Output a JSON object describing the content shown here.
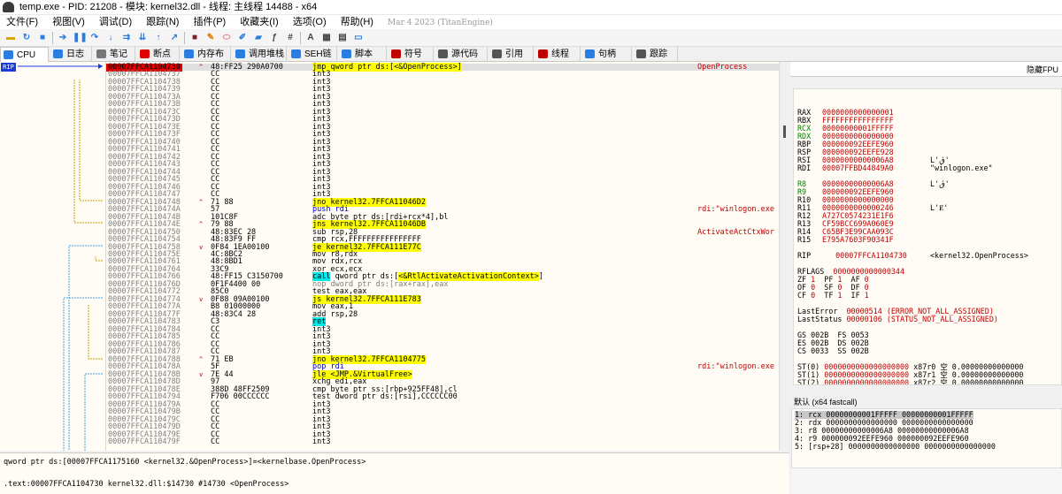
{
  "window": {
    "title": "temp.exe - PID: 21208 - 模块: kernel32.dll - 线程: 主线程 14488 - x64"
  },
  "menu": {
    "items": [
      "文件(F)",
      "视图(V)",
      "调试(D)",
      "跟踪(N)",
      "插件(P)",
      "收藏夹(I)",
      "选项(O)",
      "帮助(H)"
    ],
    "build": "Mar 4 2023 (TitanEngine)"
  },
  "toolbar": {
    "icons": [
      "open-icon",
      "restart-icon",
      "close-icon",
      "run-icon",
      "pause-icon",
      "step-into-icon",
      "step-over-icon",
      "trace-into-icon",
      "trace-over-icon",
      "execute-till-return-icon",
      "run-to-user-code-icon",
      "scylla-icon",
      "patch-icon",
      "comment-icon",
      "label-icon",
      "bookmark-icon",
      "function-icon",
      "hash-icon",
      "font-icon",
      "calc-icon",
      "log-icon",
      "screen-icon"
    ]
  },
  "tabs": [
    {
      "label": "CPU",
      "icon": "cpu-icon",
      "active": true
    },
    {
      "label": "日志",
      "icon": "log-icon"
    },
    {
      "label": "笔记",
      "icon": "notes-icon"
    },
    {
      "label": "断点",
      "icon": "breakpoint-icon"
    },
    {
      "label": "内存布局",
      "icon": "memory-icon"
    },
    {
      "label": "调用堆栈",
      "icon": "callstack-icon"
    },
    {
      "label": "SEH链",
      "icon": "seh-icon"
    },
    {
      "label": "脚本",
      "icon": "script-icon"
    },
    {
      "label": "符号",
      "icon": "symbol-icon"
    },
    {
      "label": "源代码",
      "icon": "source-icon"
    },
    {
      "label": "引用",
      "icon": "reference-icon"
    },
    {
      "label": "线程",
      "icon": "thread-icon"
    },
    {
      "label": "句柄",
      "icon": "handle-icon"
    },
    {
      "label": "跟踪",
      "icon": "trace-icon"
    }
  ],
  "rip_label": "RIP",
  "disasm": [
    {
      "addr": "00007FFCA1104730",
      "mark": "^",
      "bytes": "48:FF25 290A0700",
      "ins": "jmp qword ptr ds:[<&OpenProcess>]",
      "type": "jmp",
      "cm": "OpenProcess",
      "cur": true
    },
    {
      "addr": "00007FFCA1104737",
      "bytes": "CC",
      "ins": "int3",
      "type": "int"
    },
    {
      "addr": "00007FFCA1104738",
      "bytes": "CC",
      "ins": "int3",
      "type": "int"
    },
    {
      "addr": "00007FFCA1104739",
      "bytes": "CC",
      "ins": "int3",
      "type": "int"
    },
    {
      "addr": "00007FFCA110473A",
      "bytes": "CC",
      "ins": "int3",
      "type": "int"
    },
    {
      "addr": "00007FFCA110473B",
      "bytes": "CC",
      "ins": "int3",
      "type": "int"
    },
    {
      "addr": "00007FFCA110473C",
      "bytes": "CC",
      "ins": "int3",
      "type": "int"
    },
    {
      "addr": "00007FFCA110473D",
      "bytes": "CC",
      "ins": "int3",
      "type": "int"
    },
    {
      "addr": "00007FFCA110473E",
      "bytes": "CC",
      "ins": "int3",
      "type": "int"
    },
    {
      "addr": "00007FFCA110473F",
      "bytes": "CC",
      "ins": "int3",
      "type": "int"
    },
    {
      "addr": "00007FFCA1104740",
      "bytes": "CC",
      "ins": "int3",
      "type": "int"
    },
    {
      "addr": "00007FFCA1104741",
      "bytes": "CC",
      "ins": "int3",
      "type": "int"
    },
    {
      "addr": "00007FFCA1104742",
      "bytes": "CC",
      "ins": "int3",
      "type": "int"
    },
    {
      "addr": "00007FFCA1104743",
      "bytes": "CC",
      "ins": "int3",
      "type": "int"
    },
    {
      "addr": "00007FFCA1104744",
      "bytes": "CC",
      "ins": "int3",
      "type": "int"
    },
    {
      "addr": "00007FFCA1104745",
      "bytes": "CC",
      "ins": "int3",
      "type": "int"
    },
    {
      "addr": "00007FFCA1104746",
      "bytes": "CC",
      "ins": "int3",
      "type": "int"
    },
    {
      "addr": "00007FFCA1104747",
      "bytes": "CC",
      "ins": "int3",
      "type": "int"
    },
    {
      "addr": "00007FFCA1104748",
      "mark": "^",
      "bytes": "71 88",
      "ins": "jno kernel32.7FFCA11046D2",
      "type": "jcc"
    },
    {
      "addr": "00007FFCA110474A",
      "bytes": "57",
      "ins": "push rdi",
      "type": "push",
      "cm": "rdi:\"winlogon.exe"
    },
    {
      "addr": "00007FFCA110474B",
      "bytes": "101C8F",
      "ins": "adc byte ptr ds:[rdi+rcx*4],bl",
      "type": "mov"
    },
    {
      "addr": "00007FFCA110474E",
      "mark": "^",
      "bytes": "79 88",
      "ins": "jns kernel32.7FFCA11046DB",
      "type": "jcc"
    },
    {
      "addr": "00007FFCA1104750",
      "bytes": "48:83EC 28",
      "ins": "sub rsp,28",
      "type": "mov",
      "cm": "ActivateActCtxWor"
    },
    {
      "addr": "00007FFCA1104754",
      "bytes": "48:83F9 FF",
      "ins": "cmp rcx,FFFFFFFFFFFFFFFF",
      "type": "mov"
    },
    {
      "addr": "00007FFCA1104758",
      "mark": "v",
      "bytes": "0F84 1EA00100",
      "ins": "je kernel32.7FFCA111E77C",
      "type": "jcc"
    },
    {
      "addr": "00007FFCA110475E",
      "bytes": "4C:8BC2",
      "ins": "mov r8,rdx",
      "type": "mov"
    },
    {
      "addr": "00007FFCA1104761",
      "bytes": "48:8BD1",
      "ins": "mov rdx,rcx",
      "type": "mov"
    },
    {
      "addr": "00007FFCA1104764",
      "bytes": "33C9",
      "ins": "xor ecx,ecx",
      "type": "mov"
    },
    {
      "addr": "00007FFCA1104766",
      "bytes": "48:FF15 C3150700",
      "ins": "call qword ptr ds:[<&RtlActivateActivationContext>]",
      "type": "call"
    },
    {
      "addr": "00007FFCA110476D",
      "bytes": "0F1F4400 00",
      "ins": "nop dword ptr ds:[rax+rax],eax",
      "type": "nop"
    },
    {
      "addr": "00007FFCA1104772",
      "bytes": "85C0",
      "ins": "test eax,eax",
      "type": "mov"
    },
    {
      "addr": "00007FFCA1104774",
      "mark": "v",
      "bytes": "0F88 09A00100",
      "ins": "js kernel32.7FFCA111E783",
      "type": "jcc"
    },
    {
      "addr": "00007FFCA110477A",
      "bytes": "B8 01000000",
      "ins": "mov eax,1",
      "type": "mov"
    },
    {
      "addr": "00007FFCA110477F",
      "bytes": "48:83C4 28",
      "ins": "add rsp,28",
      "type": "mov"
    },
    {
      "addr": "00007FFCA1104783",
      "bytes": "C3",
      "ins": "ret",
      "type": "ret"
    },
    {
      "addr": "00007FFCA1104784",
      "bytes": "CC",
      "ins": "int3",
      "type": "int"
    },
    {
      "addr": "00007FFCA1104785",
      "bytes": "CC",
      "ins": "int3",
      "type": "int"
    },
    {
      "addr": "00007FFCA1104786",
      "bytes": "CC",
      "ins": "int3",
      "type": "int"
    },
    {
      "addr": "00007FFCA1104787",
      "bytes": "CC",
      "ins": "int3",
      "type": "int"
    },
    {
      "addr": "00007FFCA1104788",
      "mark": "^",
      "bytes": "71 EB",
      "ins": "jno kernel32.7FFCA1104775",
      "type": "jcc"
    },
    {
      "addr": "00007FFCA110478A",
      "bytes": "5F",
      "ins": "pop rdi",
      "type": "pop",
      "cm": "rdi:\"winlogon.exe"
    },
    {
      "addr": "00007FFCA110478B",
      "mark": "v",
      "bytes": "7E 44",
      "ins": "jle <JMP.&VirtualFree>",
      "type": "jcc"
    },
    {
      "addr": "00007FFCA110478D",
      "bytes": "97",
      "ins": "xchg edi,eax",
      "type": "mov"
    },
    {
      "addr": "00007FFCA110478E",
      "bytes": "388D 48FF2509",
      "ins": "cmp byte ptr ss:[rbp+925FF48],cl",
      "type": "mov"
    },
    {
      "addr": "00007FFCA1104794",
      "bytes": "F706 00CCCCCC",
      "ins": "test dword ptr ds:[rsi],CCCCCC00",
      "type": "mov"
    },
    {
      "addr": "00007FFCA110479A",
      "bytes": "CC",
      "ins": "int3",
      "type": "int"
    },
    {
      "addr": "00007FFCA110479B",
      "bytes": "CC",
      "ins": "int3",
      "type": "int"
    },
    {
      "addr": "00007FFCA110479C",
      "bytes": "CC",
      "ins": "int3",
      "type": "int"
    },
    {
      "addr": "00007FFCA110479D",
      "bytes": "CC",
      "ins": "int3",
      "type": "int"
    },
    {
      "addr": "00007FFCA110479E",
      "bytes": "CC",
      "ins": "int3",
      "type": "int"
    },
    {
      "addr": "00007FFCA110479F",
      "bytes": "CC",
      "ins": "int3",
      "type": "int"
    }
  ],
  "regpanel": {
    "hide_label": "隐藏FPU"
  },
  "registers": {
    "general": [
      {
        "n": "RAX",
        "v": "0000000000000001"
      },
      {
        "n": "RBX",
        "v": "FFFFFFFFFFFFFFFF"
      },
      {
        "n": "RCX",
        "v": "00000000001FFFFF",
        "g": true
      },
      {
        "n": "RDX",
        "v": "0000000000000000",
        "g": true
      },
      {
        "n": "RBP",
        "v": "000000092EEFE960"
      },
      {
        "n": "RSP",
        "v": "000000092EEFE928"
      },
      {
        "n": "RSI",
        "v": "00000000000006A8",
        "s": "L'ڨ'"
      },
      {
        "n": "RDI",
        "v": "00007FFBD44849A0",
        "s": "\"winlogon.exe\""
      },
      {
        "n": "R8",
        "v": "00000000000006A8",
        "s": "L'ڨ'",
        "g": true
      },
      {
        "n": "R9",
        "v": "000000092EEFE960",
        "g": true
      },
      {
        "n": "R10",
        "v": "0000000000000000"
      },
      {
        "n": "R11",
        "v": "0000000000000246",
        "s": "L'Ɇ'"
      },
      {
        "n": "R12",
        "v": "A727C0574231E1F6"
      },
      {
        "n": "R13",
        "v": "CF59BCC699A060E9"
      },
      {
        "n": "R14",
        "v": "C65BF3E99CAA093C"
      },
      {
        "n": "R15",
        "v": "E795A7603F90341F"
      }
    ],
    "rip": {
      "n": "RIP",
      "v": "00007FFCA1104730",
      "s": "<kernel32.OpenProcess>"
    },
    "rflags": {
      "n": "RFLAGS",
      "v": "0000000000000344"
    },
    "flags": [
      "ZF 1  PF 1  AF 0",
      "OF 0  SF 0  DF 0",
      "CF 0  TF 1  IF 1"
    ],
    "last_error": {
      "label": "LastError",
      "v": "00000514 (ERROR_NOT_ALL_ASSIGNED)"
    },
    "last_status": {
      "label": "LastStatus",
      "v": "00000106 (STATUS_NOT_ALL_ASSIGNED)"
    },
    "segments": [
      "GS 002B  FS 0053",
      "ES 002B  DS 002B",
      "CS 0033  SS 002B"
    ],
    "fpu": [
      "ST(0) 0000000000000000000 x87r0 空 0.00000000000000",
      "ST(1) 0000000000000000000 x87r1 空 0.00000000000000",
      "ST(2) 0000000000000000000 x87r2 空 0.00000000000000",
      "ST(3) 0000000000000000000 x87r3 空 0.00000000000000",
      "ST(4) 0000000000000000000 x87r4 空 0.00000000000000"
    ]
  },
  "callconv": {
    "label": "默认 (x64 fastcall)"
  },
  "stack_args": [
    "1: rcx 00000000001FFFFF 00000000001FFFFF",
    "2: rdx 0000000000000000 0000000000000000",
    "3: r8 00000000000006A8 00000000000006A8",
    "4: r9 000000092EEFE960 000000092EEFE960",
    "5: [rsp+28] 0000000000000000 0000000000000000"
  ],
  "info": {
    "line1": "qword ptr ds:[00007FFCA1175160 <kernel32.&OpenProcess>]=<kernelbase.OpenProcess>",
    "line2": ".text:00007FFCA1104730 kernel32.dll:$14730 #14730 <OpenProcess>"
  },
  "colors": {
    "accent_red": "#c00000",
    "highlight_yellow": "#ffff00",
    "call_cyan": "#00e8e8",
    "rip_blue": "#1b3bd6",
    "modified_green": "#008000"
  }
}
